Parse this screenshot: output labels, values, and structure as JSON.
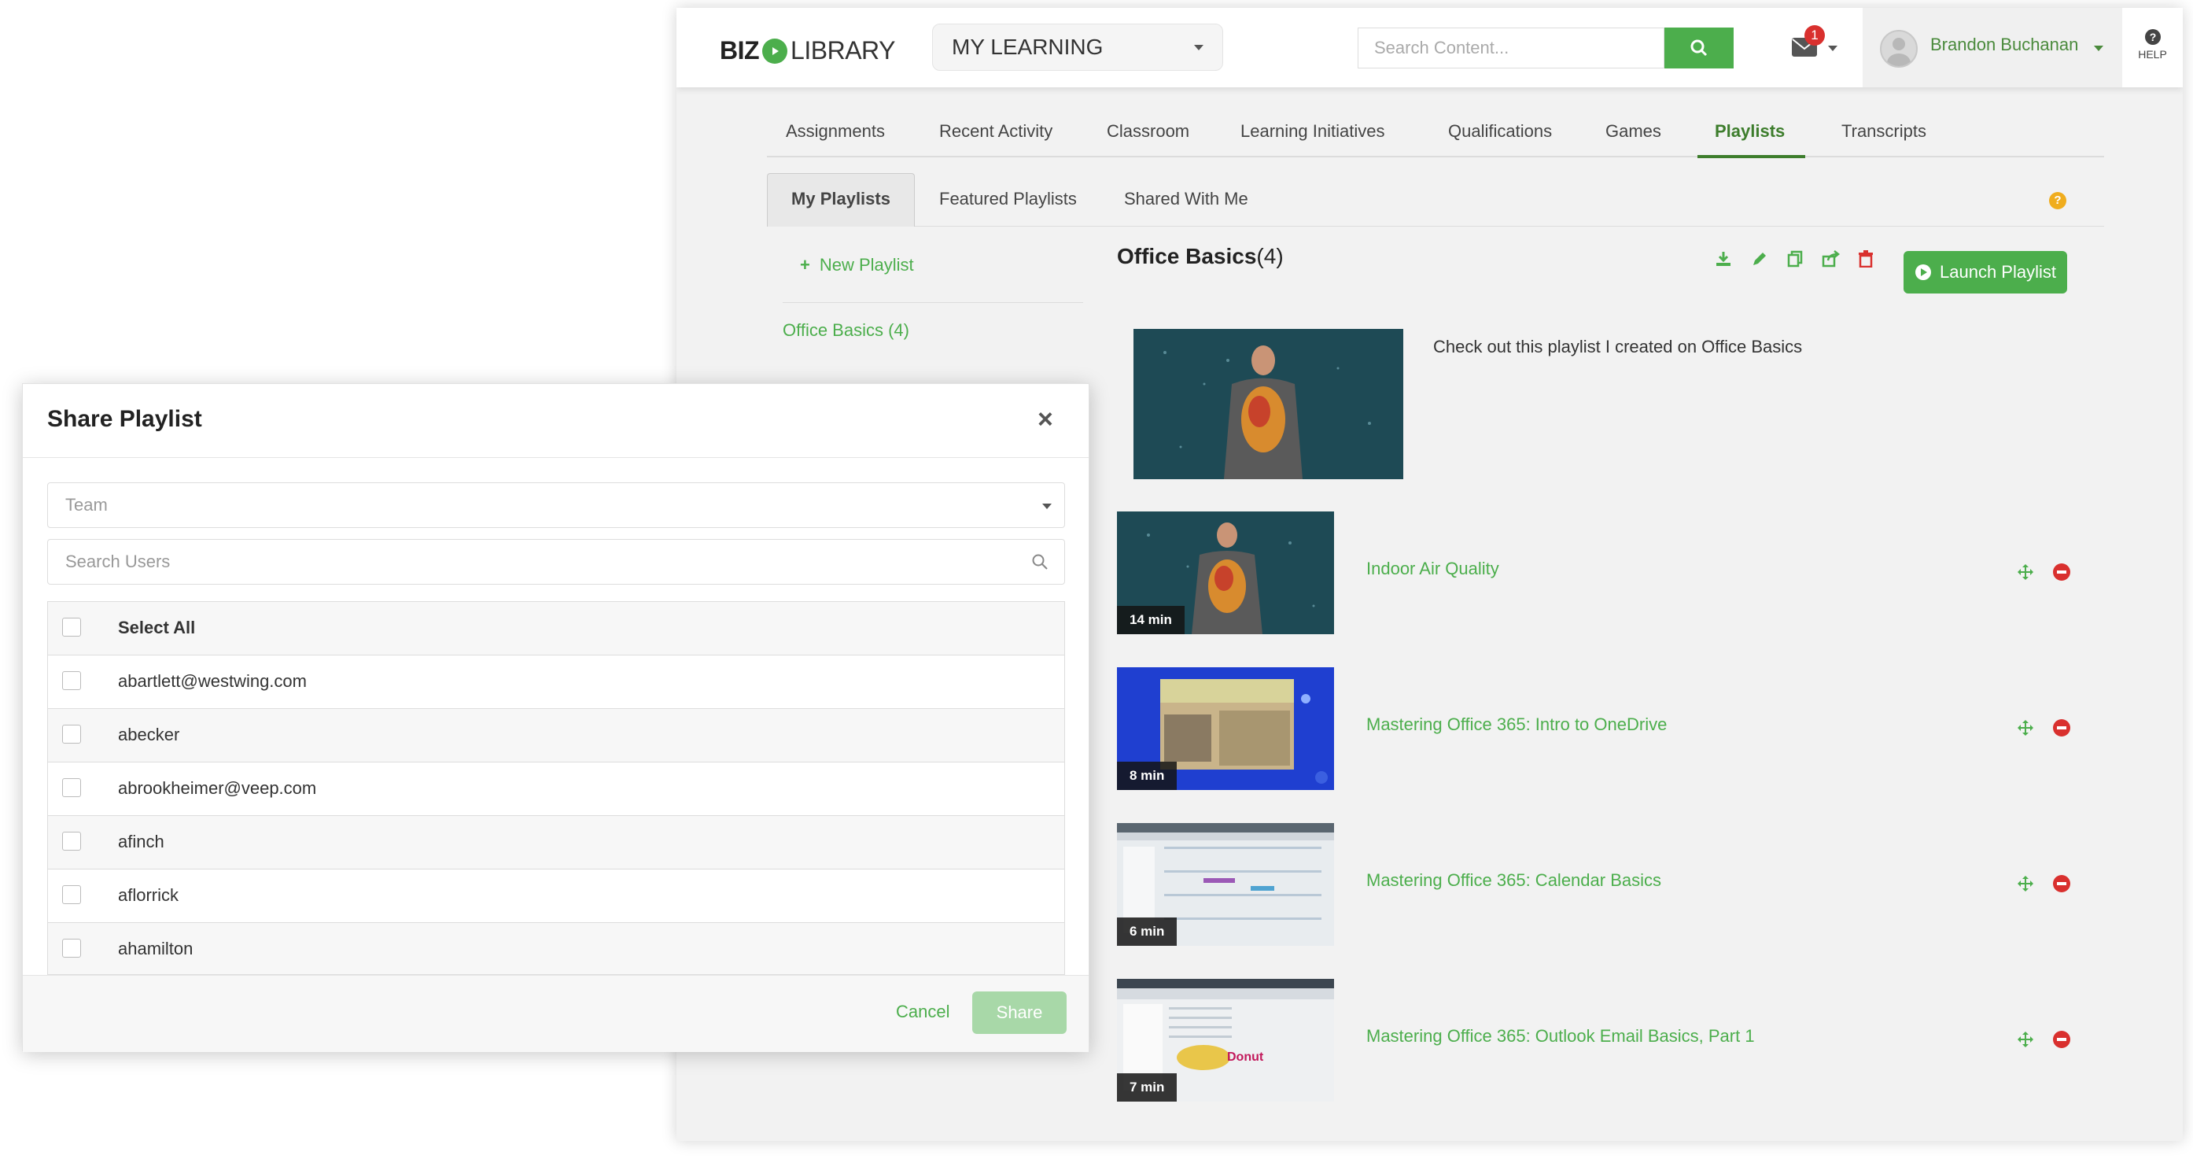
{
  "brand": {
    "logo_left": "BIZ",
    "logo_right": "LIBRARY",
    "accent": "#4cae4c"
  },
  "header": {
    "mode_select": "MY LEARNING",
    "search_placeholder": "Search Content...",
    "notification_count": "1",
    "user_name": "Brandon Buchanan",
    "help_label": "HELP"
  },
  "tabs": [
    {
      "label": "Assignments"
    },
    {
      "label": "Recent Activity"
    },
    {
      "label": "Classroom"
    },
    {
      "label": "Learning Initiatives"
    },
    {
      "label": "Qualifications"
    },
    {
      "label": "Games"
    },
    {
      "label": "Playlists"
    },
    {
      "label": "Transcripts"
    }
  ],
  "subtabs": [
    {
      "label": "My Playlists"
    },
    {
      "label": "Featured Playlists"
    },
    {
      "label": "Shared With Me"
    }
  ],
  "left_panel": {
    "new_playlist": "New Playlist",
    "playlists": [
      {
        "label": "Office Basics (4)"
      }
    ]
  },
  "playlist": {
    "title": "Office Basics",
    "count": "(4)",
    "launch_label": "Launch Playlist",
    "description": "Check out this playlist I created on Office Basics",
    "items": [
      {
        "title": "Indoor Air Quality",
        "duration": "14 min"
      },
      {
        "title": "Mastering Office 365: Intro to OneDrive",
        "duration": "8 min"
      },
      {
        "title": "Mastering Office 365: Calendar Basics",
        "duration": "6 min"
      },
      {
        "title": "Mastering Office 365: Outlook Email Basics, Part 1",
        "duration": "7 min"
      }
    ]
  },
  "modal": {
    "title": "Share Playlist",
    "team_placeholder": "Team",
    "search_placeholder": "Search Users",
    "select_all": "Select All",
    "users": [
      {
        "name": "abartlett@westwing.com"
      },
      {
        "name": "abecker"
      },
      {
        "name": "abrookheimer@veep.com"
      },
      {
        "name": "afinch"
      },
      {
        "name": "aflorrick"
      },
      {
        "name": "ahamilton"
      }
    ],
    "cancel_label": "Cancel",
    "share_label": "Share"
  }
}
